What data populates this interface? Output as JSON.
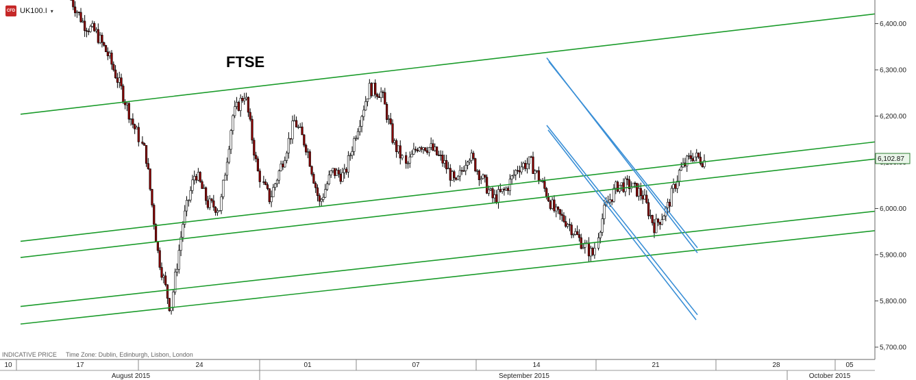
{
  "symbol": {
    "name": "UK100.I",
    "icon": "cfd-flag-icon",
    "icon_text": "CFD",
    "dropdown_glyph": "▾"
  },
  "footer": {
    "indicative": "INDICATIVE PRICE",
    "timezone": "Time Zone: Dublin, Edinburgh, Lisbon, London"
  },
  "colors": {
    "up": "#ffffff",
    "down": "#8b0000",
    "wick": "#000000",
    "channel_green": "#1a9b2a",
    "channel_blue": "#3a8fd6",
    "price_tag_border": "#2e7d32"
  },
  "chart_data": {
    "type": "candlestick",
    "title": "FTSE",
    "price_label": "6,102.87",
    "ylim": [
      5680,
      6450
    ],
    "y_ticks": [
      5700,
      5800,
      5900,
      6000,
      6100,
      6200,
      6300,
      6400
    ],
    "y_tick_labels": [
      "5,700.00",
      "5,800.00",
      "5,900.00",
      "6,000.00",
      "6,100.00",
      "6,200.00",
      "6,300.00",
      "6,400.00"
    ],
    "x_day_labels": [
      "10",
      "17",
      "24",
      "01",
      "07",
      "14",
      "21",
      "28",
      "05"
    ],
    "x_month_labels": [
      "August 2015",
      "September 2015",
      "October 2015"
    ],
    "series_close_path": [
      {
        "t": "Aug 13",
        "v": 6452
      },
      {
        "t": "Aug 14",
        "v": 6400
      },
      {
        "t": "Aug 17",
        "v": 6380
      },
      {
        "t": "Aug 18",
        "v": 6330
      },
      {
        "t": "Aug 19",
        "v": 6260
      },
      {
        "t": "Aug 20",
        "v": 6180
      },
      {
        "t": "Aug 21",
        "v": 6120
      },
      {
        "t": "Aug 24",
        "v": 5900
      },
      {
        "t": "Aug 24b",
        "v": 5780
      },
      {
        "t": "Aug 25",
        "v": 5970
      },
      {
        "t": "Aug 26",
        "v": 6080
      },
      {
        "t": "Aug 27",
        "v": 6010
      },
      {
        "t": "Aug 28",
        "v": 6000
      },
      {
        "t": "Aug 31",
        "v": 6200
      },
      {
        "t": "Sep 01",
        "v": 6250
      },
      {
        "t": "Sep 02",
        "v": 6080
      },
      {
        "t": "Sep 03",
        "v": 6020
      },
      {
        "t": "Sep 04",
        "v": 6100
      },
      {
        "t": "Sep 07",
        "v": 6190
      },
      {
        "t": "Sep 08",
        "v": 6130
      },
      {
        "t": "Sep 09",
        "v": 6010
      },
      {
        "t": "Sep 10",
        "v": 6080
      },
      {
        "t": "Sep 11",
        "v": 6070
      },
      {
        "t": "Sep 14",
        "v": 6170
      },
      {
        "t": "Sep 15",
        "v": 6260
      },
      {
        "t": "Sep 16",
        "v": 6250
      },
      {
        "t": "Sep 17",
        "v": 6140
      },
      {
        "t": "Sep 18",
        "v": 6090
      },
      {
        "t": "Sep 21",
        "v": 6140
      },
      {
        "t": "Sep 22",
        "v": 6130
      },
      {
        "t": "Sep 23",
        "v": 6100
      },
      {
        "t": "Sep 24",
        "v": 6050
      },
      {
        "t": "Sep 25",
        "v": 6120
      },
      {
        "t": "Sep 28",
        "v": 6070
      },
      {
        "t": "Sep 29",
        "v": 6020
      },
      {
        "t": "Sep 30",
        "v": 6040
      },
      {
        "t": "Oct 01",
        "v": 6090
      },
      {
        "t": "Oct 02",
        "v": 6100
      },
      {
        "t": "Oct 05",
        "v": 6050
      },
      {
        "t": "Oct 06",
        "v": 5990
      },
      {
        "t": "Oct 07",
        "v": 5970
      },
      {
        "t": "Oct 08",
        "v": 5930
      },
      {
        "t": "Oct 09",
        "v": 5900
      },
      {
        "t": "Oct 12",
        "v": 6000
      },
      {
        "t": "Oct 13",
        "v": 6050
      },
      {
        "t": "Oct 14",
        "v": 6050
      },
      {
        "t": "Oct 15",
        "v": 6030
      },
      {
        "t": "Oct 16",
        "v": 5960
      },
      {
        "t": "Oct 19",
        "v": 6000
      },
      {
        "t": "Oct 20",
        "v": 6080
      },
      {
        "t": "Oct 21",
        "v": 6115
      },
      {
        "t": "Oct 22",
        "v": 6102.87
      }
    ],
    "green_channels": [
      {
        "name": "upper-channel-top",
        "v0": 6204,
        "v1": 6421
      },
      {
        "name": "upper-channel-mid",
        "v0": 5929,
        "v1": 6144
      },
      {
        "name": "upper-channel-bottom",
        "v0": 5894,
        "v1": 6107
      },
      {
        "name": "lower-channel-top",
        "v0": 5788,
        "v1": 5994
      },
      {
        "name": "lower-channel-bottom",
        "v0": 5750,
        "v1": 5952
      }
    ],
    "blue_channels": [
      {
        "name": "down-channel-outer-top",
        "v0": 6326,
        "v1": 5904
      },
      {
        "name": "down-channel-inner-top",
        "v0": 6318,
        "v1": 5915
      },
      {
        "name": "down-channel-outer-bottom",
        "v0": 6180,
        "v1": 5770
      },
      {
        "name": "down-channel-inner-bottom",
        "v0": 6170,
        "v1": 5759
      }
    ]
  }
}
